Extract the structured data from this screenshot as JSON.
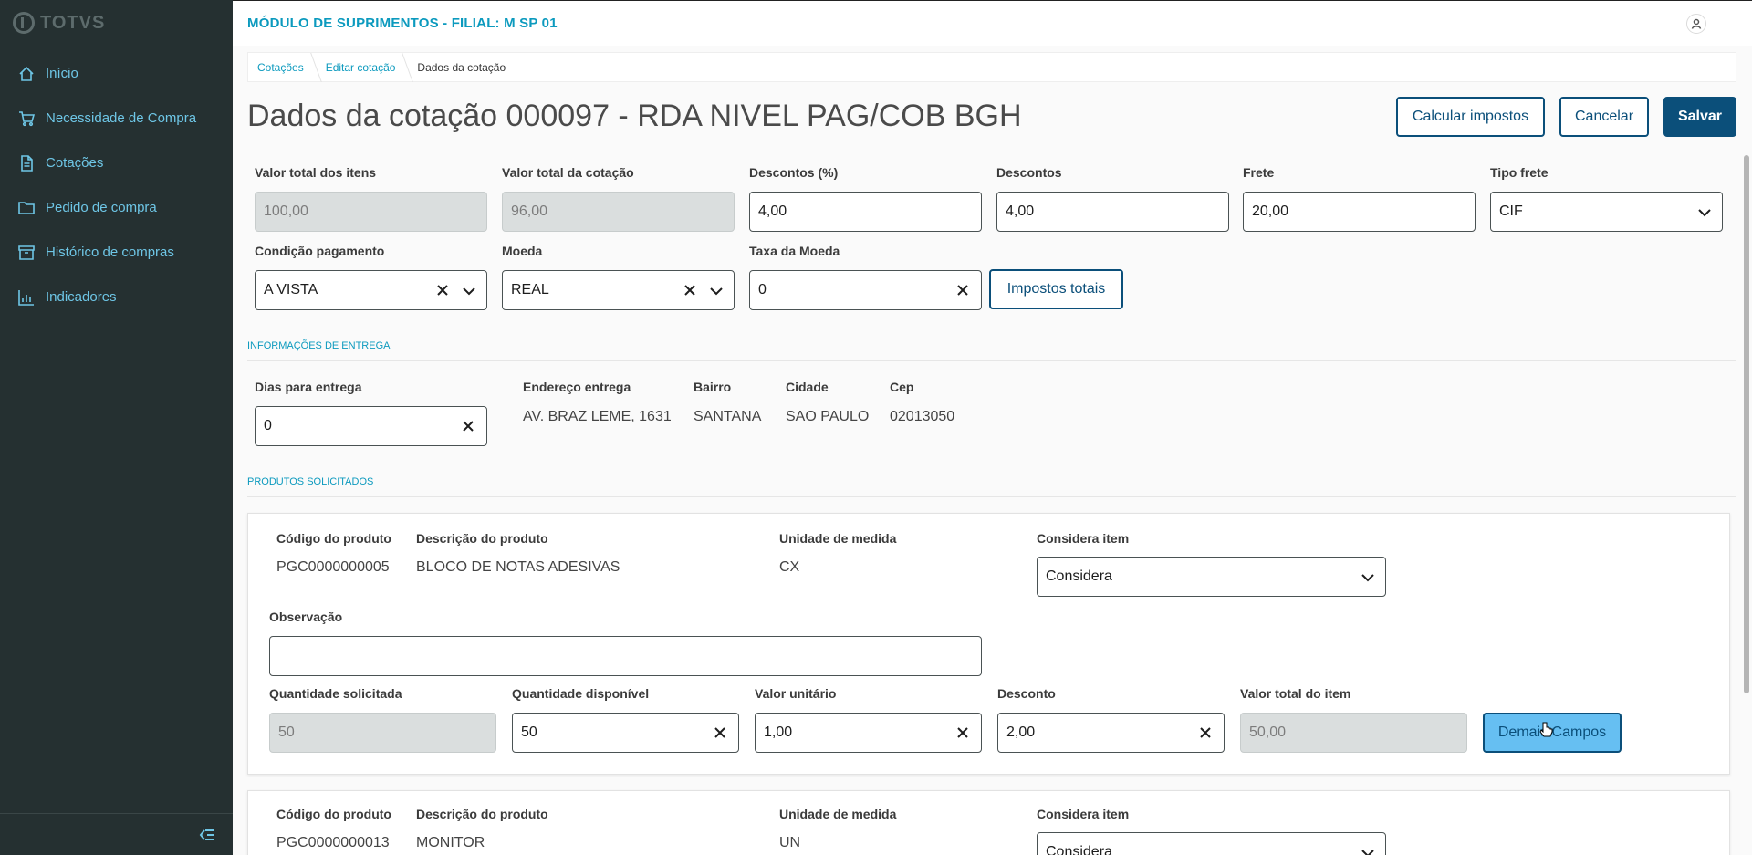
{
  "sidebar": {
    "logo": "TOTVS",
    "items": [
      {
        "label": "Início",
        "icon": "home-icon"
      },
      {
        "label": "Necessidade de Compra",
        "icon": "cart-icon"
      },
      {
        "label": "Cotações",
        "icon": "document-icon"
      },
      {
        "label": "Pedido de compra",
        "icon": "folder-icon"
      },
      {
        "label": "Histórico de compras",
        "icon": "archive-icon"
      },
      {
        "label": "Indicadores",
        "icon": "chart-icon"
      }
    ]
  },
  "header": {
    "module_title": "MÓDULO DE SUPRIMENTOS - FILIAL: M SP 01"
  },
  "breadcrumb": [
    "Cotações",
    "Editar cotação",
    "Dados da cotação"
  ],
  "page": {
    "title": "Dados da cotação 000097 - RDA NIVEL PAG/COB BGH",
    "actions": {
      "calc_taxes": "Calcular impostos",
      "cancel": "Cancelar",
      "save": "Salvar"
    }
  },
  "form": {
    "valor_total_itens": {
      "label": "Valor total dos itens",
      "value": "100,00"
    },
    "valor_total_cotacao": {
      "label": "Valor total da cotação",
      "value": "96,00"
    },
    "descontos_pct": {
      "label": "Descontos (%)",
      "value": "4,00"
    },
    "descontos": {
      "label": "Descontos",
      "value": "4,00"
    },
    "frete": {
      "label": "Frete",
      "value": "20,00"
    },
    "tipo_frete": {
      "label": "Tipo frete",
      "value": "CIF"
    },
    "condicao_pagamento": {
      "label": "Condição pagamento",
      "value": "A VISTA"
    },
    "moeda": {
      "label": "Moeda",
      "value": "REAL"
    },
    "taxa_moeda": {
      "label": "Taxa da Moeda",
      "value": "0"
    },
    "impostos_totais": "Impostos totais"
  },
  "entrega": {
    "section_title": "INFORMAÇÕES DE ENTREGA",
    "dias": {
      "label": "Dias para entrega",
      "value": "0"
    },
    "endereco": {
      "label": "Endereço entrega",
      "value": "AV. BRAZ LEME, 1631"
    },
    "bairro": {
      "label": "Bairro",
      "value": "SANTANA"
    },
    "cidade": {
      "label": "Cidade",
      "value": "SAO PAULO"
    },
    "cep": {
      "label": "Cep",
      "value": "02013050"
    }
  },
  "produtos": {
    "section_title": "PRODUTOS SOLICITADOS",
    "labels": {
      "codigo": "Código do produto",
      "descricao": "Descrição do produto",
      "unidade": "Unidade de medida",
      "considera": "Considera item",
      "observacao": "Observação",
      "qtd_solicitada": "Quantidade solicitada",
      "qtd_disponivel": "Quantidade disponível",
      "valor_unitario": "Valor unitário",
      "desconto": "Desconto",
      "valor_total": "Valor total do item",
      "demais_campos": "Demais Campos"
    },
    "items": [
      {
        "codigo": "PGC0000000005",
        "descricao": "BLOCO DE NOTAS ADESIVAS",
        "unidade": "CX",
        "considera": "Considera",
        "observacao": "",
        "qtd_solicitada": "50",
        "qtd_disponivel": "50",
        "valor_unitario": "1,00",
        "desconto": "2,00",
        "valor_total": "50,00"
      },
      {
        "codigo": "PGC0000000013",
        "descricao": "MONITOR",
        "unidade": "UN",
        "considera": "Considera"
      }
    ]
  }
}
